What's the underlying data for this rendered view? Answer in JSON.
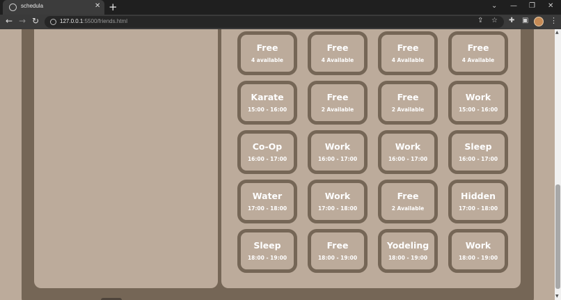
{
  "browser": {
    "tab_title": "schedula",
    "close_glyph": "✕",
    "new_tab_glyph": "+",
    "url_host": "127.0.0.1",
    "url_path": ":5500/friends.html",
    "icons": [
      "back-arrow-icon",
      "forward-arrow-icon",
      "reload-icon",
      "share-icon",
      "star-icon",
      "extensions-icon",
      "sidepanel-icon",
      "menu-icon"
    ]
  },
  "schedule": {
    "slots": [
      {
        "title": "Free",
        "sub": "4 available"
      },
      {
        "title": "Free",
        "sub": "4 Available"
      },
      {
        "title": "Free",
        "sub": "4 Available"
      },
      {
        "title": "Free",
        "sub": "4 Available"
      },
      {
        "title": "Karate",
        "sub": "15:00 - 16:00"
      },
      {
        "title": "Free",
        "sub": "2 Available"
      },
      {
        "title": "Free",
        "sub": "2 Available"
      },
      {
        "title": "Work",
        "sub": "15:00 - 16:00"
      },
      {
        "title": "Co-Op",
        "sub": "16:00 - 17:00"
      },
      {
        "title": "Work",
        "sub": "16:00 - 17:00"
      },
      {
        "title": "Work",
        "sub": "16:00 - 17:00"
      },
      {
        "title": "Sleep",
        "sub": "16:00 - 17:00"
      },
      {
        "title": "Water",
        "sub": "17:00 - 18:00"
      },
      {
        "title": "Work",
        "sub": "17:00 - 18:00"
      },
      {
        "title": "Free",
        "sub": "2 Available"
      },
      {
        "title": "Hidden",
        "sub": "17:00 - 18:00"
      },
      {
        "title": "Sleep",
        "sub": "18:00 - 19:00"
      },
      {
        "title": "Free",
        "sub": "18:00 - 19:00"
      },
      {
        "title": "Yodeling",
        "sub": "18:00 - 19:00"
      },
      {
        "title": "Work",
        "sub": "18:00 - 19:00"
      }
    ]
  },
  "colors": {
    "page_bg": "#bcab9b",
    "panel_dark": "#756656",
    "text": "#ffffff"
  }
}
